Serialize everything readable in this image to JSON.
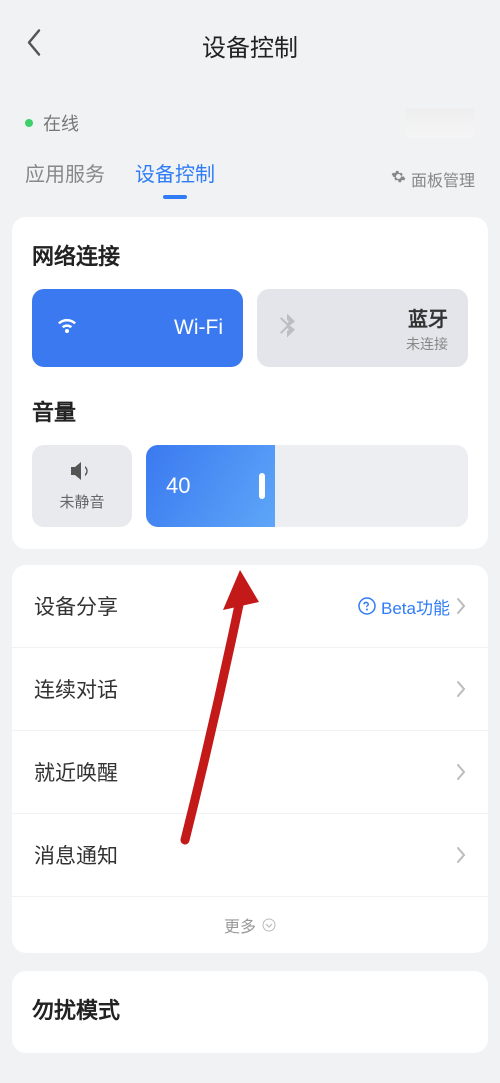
{
  "header": {
    "title": "设备控制"
  },
  "status": {
    "online_label": "在线"
  },
  "tabs": {
    "items": [
      {
        "label": "应用服务"
      },
      {
        "label": "设备控制"
      }
    ],
    "active_index": 1,
    "panel_mgmt_label": "面板管理"
  },
  "network": {
    "section_title": "网络连接",
    "wifi": {
      "label": "Wi-Fi"
    },
    "bluetooth": {
      "label": "蓝牙",
      "status": "未连接"
    }
  },
  "volume": {
    "section_title": "音量",
    "mute_label": "未静音",
    "value": "40"
  },
  "settings_rows": {
    "share": {
      "label": "设备分享",
      "beta_label": "Beta功能"
    },
    "continuous": {
      "label": "连续对话"
    },
    "nearby_wake": {
      "label": "就近唤醒"
    },
    "message_notify": {
      "label": "消息通知"
    },
    "more_label": "更多"
  },
  "dnd": {
    "title": "勿扰模式"
  }
}
